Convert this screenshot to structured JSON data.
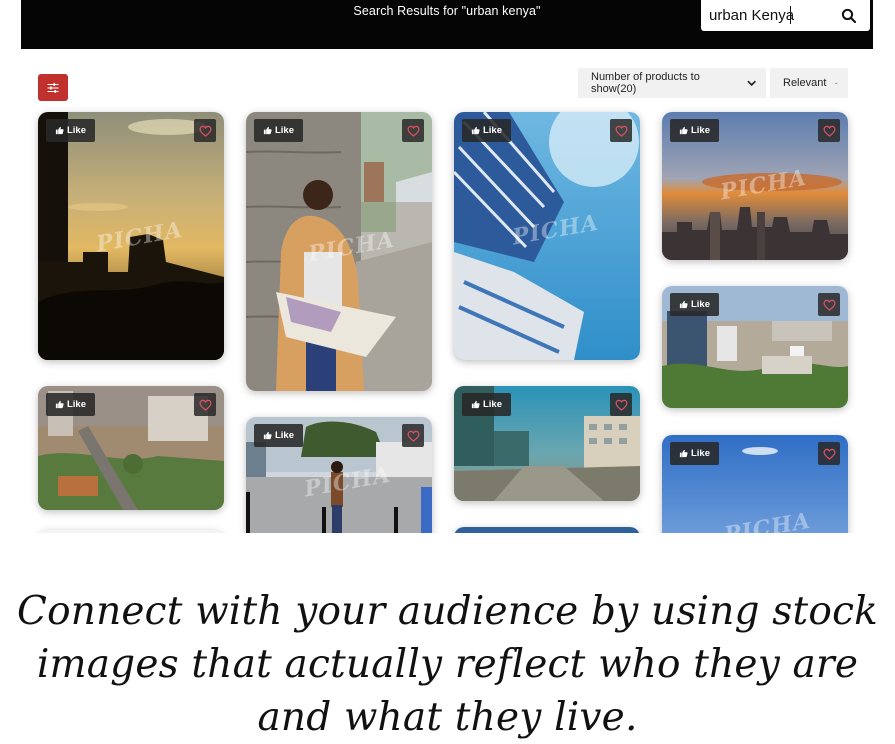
{
  "header": {
    "title": "Search Results for \"urban kenya\"",
    "search_value": "urban Kenya",
    "search_icon": "search-icon"
  },
  "controls": {
    "filter_icon": "sliders-icon",
    "count_label": "Number of products to show(20)",
    "sort_label": "Relevant"
  },
  "cards": [
    {
      "id": "sunset-silhouette",
      "like_label": "Like",
      "watermark": "PICHA"
    },
    {
      "id": "woman-reading-newspaper",
      "like_label": "Like",
      "watermark": "PICHA"
    },
    {
      "id": "glass-tower-sky",
      "like_label": "Like",
      "watermark": "PICHA"
    },
    {
      "id": "city-skyline-dusk",
      "like_label": "Like",
      "watermark": "PICHA"
    },
    {
      "id": "aerial-city-roundabout",
      "like_label": "Like",
      "watermark": ""
    },
    {
      "id": "woman-crossing-street",
      "like_label": "Like",
      "watermark": "PICHA"
    },
    {
      "id": "aerial-city-buildings",
      "like_label": "Like",
      "watermark": ""
    },
    {
      "id": "street-buildings",
      "like_label": "Like",
      "watermark": "PICHA"
    },
    {
      "id": "blue-sky-clouds",
      "like_label": "Like",
      "watermark": "PICHA"
    }
  ],
  "tagline": "Connect with your audience by using stock images that actually reflect who they are and what they live.",
  "colors": {
    "topbar": "#050505",
    "filter_button": "#c0302d",
    "dropdown_bg": "#f1f1f1",
    "heart_outline": "#e05060"
  }
}
